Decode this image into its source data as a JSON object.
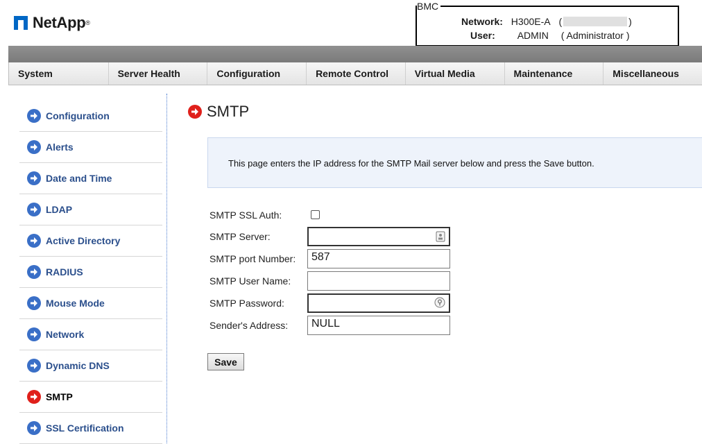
{
  "brand": {
    "name": "NetApp",
    "reg": "®"
  },
  "bmc": {
    "legend": "BMC",
    "network_label": "Network:",
    "network_value": "H300E-A",
    "network_paren_open": "(",
    "network_paren_close": ")",
    "user_label": "User:",
    "user_value": "ADMIN",
    "user_role": "( Administrator )"
  },
  "menu": [
    "System",
    "Server Health",
    "Configuration",
    "Remote Control",
    "Virtual Media",
    "Maintenance",
    "Miscellaneous"
  ],
  "sidebar": {
    "items": [
      {
        "label": "Configuration",
        "active": false
      },
      {
        "label": "Alerts",
        "active": false
      },
      {
        "label": "Date and Time",
        "active": false
      },
      {
        "label": "LDAP",
        "active": false
      },
      {
        "label": "Active Directory",
        "active": false
      },
      {
        "label": "RADIUS",
        "active": false
      },
      {
        "label": "Mouse Mode",
        "active": false
      },
      {
        "label": "Network",
        "active": false
      },
      {
        "label": "Dynamic DNS",
        "active": false
      },
      {
        "label": "SMTP",
        "active": true
      },
      {
        "label": "SSL Certification",
        "active": false
      }
    ]
  },
  "main": {
    "title": "SMTP",
    "info": "This page enters the IP address for the SMTP Mail server below and press the Save button.",
    "form": {
      "ssl_auth_label": "SMTP SSL Auth:",
      "ssl_auth_checked": false,
      "server_label": "SMTP Server:",
      "server_value": "",
      "port_label": "SMTP port Number:",
      "port_value": "587",
      "username_label": "SMTP User Name:",
      "username_value": "",
      "password_label": "SMTP Password:",
      "password_value": "",
      "sender_label": "Sender's Address:",
      "sender_value": "NULL"
    },
    "save_label": "Save"
  },
  "colors": {
    "accent_blue": "#3a6fc7",
    "active_red": "#e0201b",
    "link_text": "#2b4f8c"
  }
}
